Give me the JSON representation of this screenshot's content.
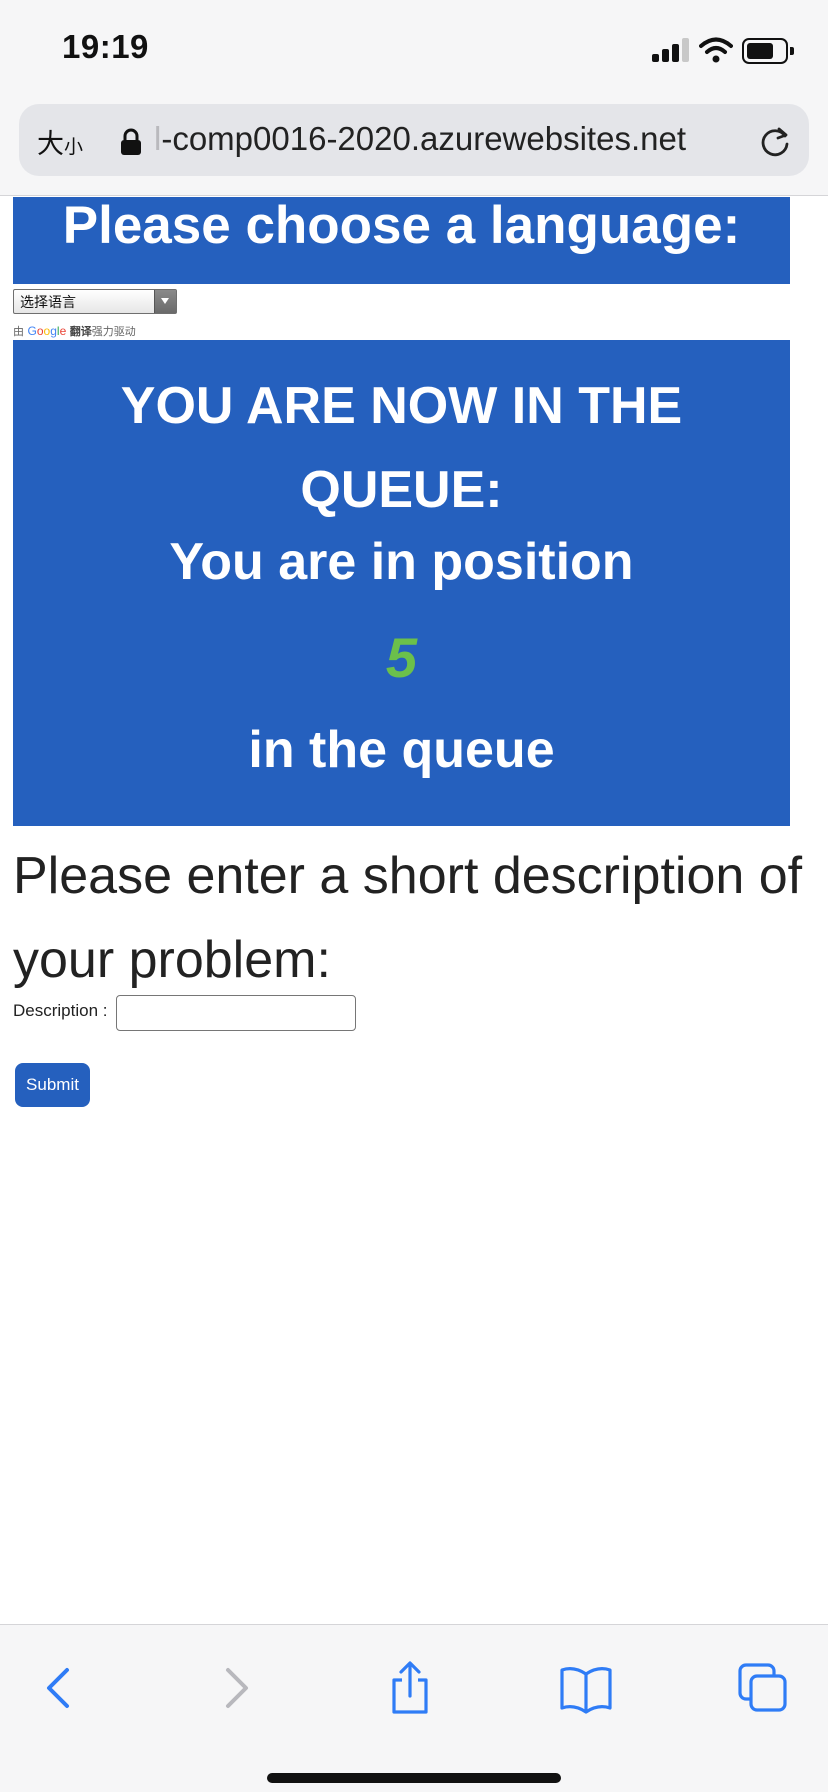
{
  "status_bar": {
    "time": "19:19"
  },
  "address_bar": {
    "text_size_large": "大",
    "text_size_small": "小",
    "url_faded_prefix": "l",
    "url_text": "-comp0016-2020.azurewebsites.net",
    "icons": [
      "lock-icon",
      "reload-icon"
    ]
  },
  "language": {
    "banner_title": "Please choose a language:",
    "select_value": "选择语言",
    "powered_prefix": "由",
    "powered_google": "Google",
    "powered_translate": "翻译",
    "powered_suffix": "强力驱动"
  },
  "queue": {
    "title": "YOU ARE NOW IN THE QUEUE:",
    "position_label": "You are in position",
    "position": "5",
    "position_suffix": "in the queue",
    "number_color": "#6bc04b",
    "box_color": "#2560be"
  },
  "form": {
    "heading": "Please enter a short description of your problem:",
    "description_label": "Description :",
    "description_value": "",
    "submit_label": "Submit"
  },
  "toolbar": {
    "icons": [
      "back-icon",
      "forward-icon",
      "share-icon",
      "bookmarks-icon",
      "tabs-icon"
    ]
  }
}
